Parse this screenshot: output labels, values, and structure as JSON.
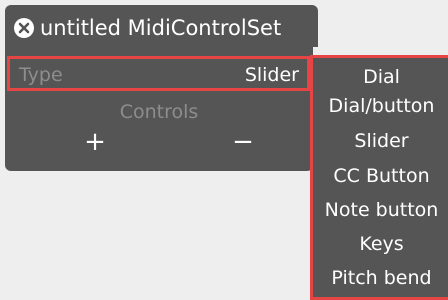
{
  "window": {
    "title": "untitled MidiControlSet"
  },
  "type_row": {
    "label": "Type",
    "value": "Slider"
  },
  "controls": {
    "label": "Controls",
    "add": "+",
    "remove": "−"
  },
  "dropdown": {
    "options": [
      "Dial",
      "Dial/button",
      "Slider",
      "CC Button",
      "Note button",
      "Keys",
      "Pitch bend"
    ]
  },
  "colors": {
    "panel": "#555555",
    "highlight": "#e54545",
    "muted_text": "#8d8d8d",
    "text": "#ffffff",
    "background": "#eeeeee"
  },
  "icons": {
    "close": "close-icon"
  }
}
